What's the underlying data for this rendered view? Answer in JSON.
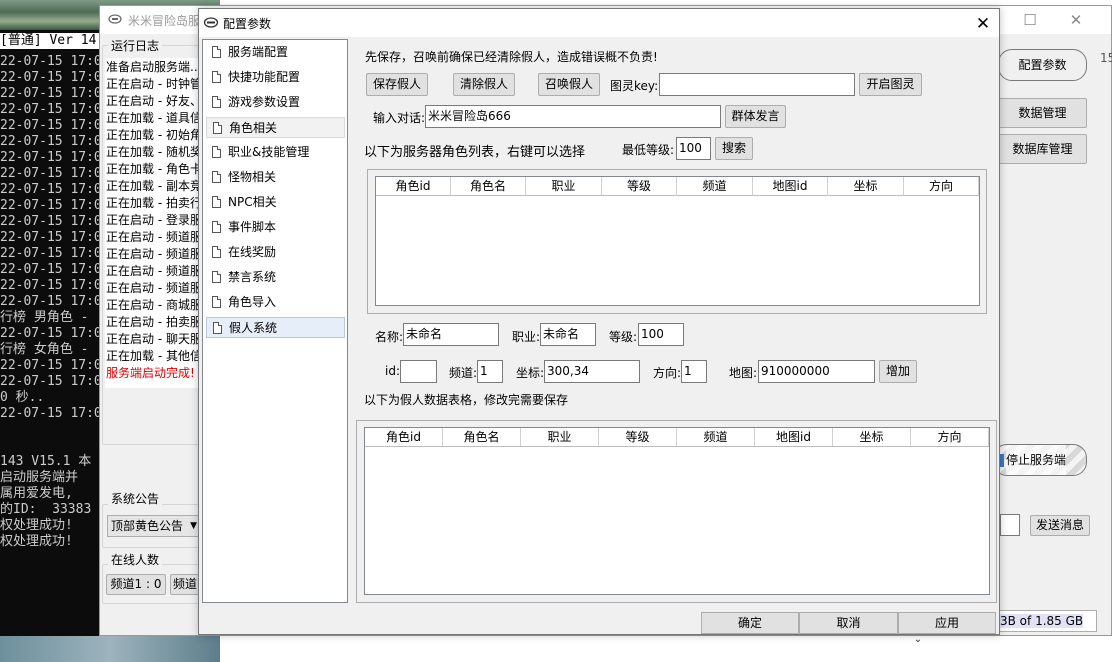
{
  "console": {
    "header": "[普通] Ver 14",
    "lines": [
      "22-07-15 17:0",
      "22-07-15 17:0",
      "22-07-15 17:0",
      "22-07-15 17:0",
      "22-07-15 17:0",
      "22-07-15 17:0",
      "22-07-15 17:0",
      "22-07-15 17:0",
      "22-07-15 17:0",
      "22-07-15 17:0",
      "22-07-15 17:0",
      "22-07-15 17:0",
      "22-07-15 17:0",
      "22-07-15 17:0",
      "22-07-15 17:0",
      "22-07-15 17:0",
      "行榜 男角色 -",
      "22-07-15 17:0",
      "行榜 女角色 -",
      "22-07-15 17:0",
      "22-07-15 17:0",
      "0 秒..",
      "22-07-15 17:0",
      "",
      "",
      "143 V15.1 本",
      "启动服务端并",
      "属用爱发电,",
      "的ID:  33383",
      "权处理成功!",
      "权处理成功!"
    ]
  },
  "main_window": {
    "title": "米米冒险岛服",
    "log_group": "运行日志",
    "log_lines": [
      "准备启动服务端...",
      "正在启动 - 时钟管",
      "正在启动 - 好友、",
      "正在加载 - 道具信",
      "正在加载 - 初始角",
      "正在加载 - 随机奖",
      "正在加载 - 角色卡",
      "正在加载 - 副本竞",
      "正在加载 - 拍卖行",
      "正在启动 - 登录服",
      "正在启动 - 频道服",
      "正在启动 - 频道服",
      "正在启动 - 频道服",
      "正在启动 - 频道服",
      "正在启动 - 商城服",
      "正在启动 - 拍卖服",
      "正在启动 - 聊天服",
      "正在加载 - 其他信"
    ],
    "log_done": "服务端启动完成!",
    "notice_group": "系统公告",
    "notice_select": "顶部黄色公告",
    "online_group": "在线人数",
    "channel1": "频道1 : 0",
    "channel2": "频道",
    "right_buttons": {
      "config": "配置参数",
      "data_manage": "数据管理",
      "db_manage": "数据库管理",
      "stop_server": "停止服务端",
      "send_message": "发送消息"
    },
    "memory_status": "3B of 1.85 GB",
    "side_number": "15"
  },
  "dialog": {
    "title": "配置参数",
    "nav_items": [
      "服务端配置",
      "快捷功能配置",
      "游戏参数设置",
      "角色相关",
      "职业&技能管理",
      "怪物相关",
      "NPC相关",
      "事件脚本",
      "在线奖励",
      "禁言系统",
      "角色导入",
      "假人系统"
    ],
    "warning": "先保存，召唤前确保已经清除假人，造成错误概不负责!",
    "buttons": {
      "save_fake": "保存假人",
      "clear_fake": "清除假人",
      "summon_fake": "召唤假人",
      "open_tuling": "开启图灵",
      "group_say": "群体发言",
      "search": "搜索",
      "add": "增加",
      "ok": "确定",
      "cancel": "取消",
      "apply": "应用"
    },
    "tuling_label": "图灵key:",
    "tuling_value": "",
    "dialog_label": "输入对话:",
    "dialog_value": "米米冒险岛666",
    "list_intro": "以下为服务器角色列表，右键可以选择",
    "min_level_label": "最低等级:",
    "min_level_value": "100",
    "server_table_cols": [
      "角色id",
      "角色名",
      "职业",
      "等级",
      "频道",
      "地图id",
      "坐标",
      "方向"
    ],
    "form": {
      "name_label": "名称:",
      "name_value": "未命名",
      "job_label": "职业:",
      "job_value": "未命名",
      "level_label": "等级:",
      "level_value": "100",
      "id_label": "id:",
      "id_value": "",
      "channel_label": "频道:",
      "channel_value": "1",
      "coord_label": "坐标:",
      "coord_value": "300,34",
      "dir_label": "方向:",
      "dir_value": "1",
      "map_label": "地图:",
      "map_value": "910000000"
    },
    "fake_intro": "以下为假人数据表格，修改完需要保存",
    "fake_table_cols": [
      "角色id",
      "角色名",
      "职业",
      "等级",
      "频道",
      "地图id",
      "坐标",
      "方向"
    ]
  }
}
